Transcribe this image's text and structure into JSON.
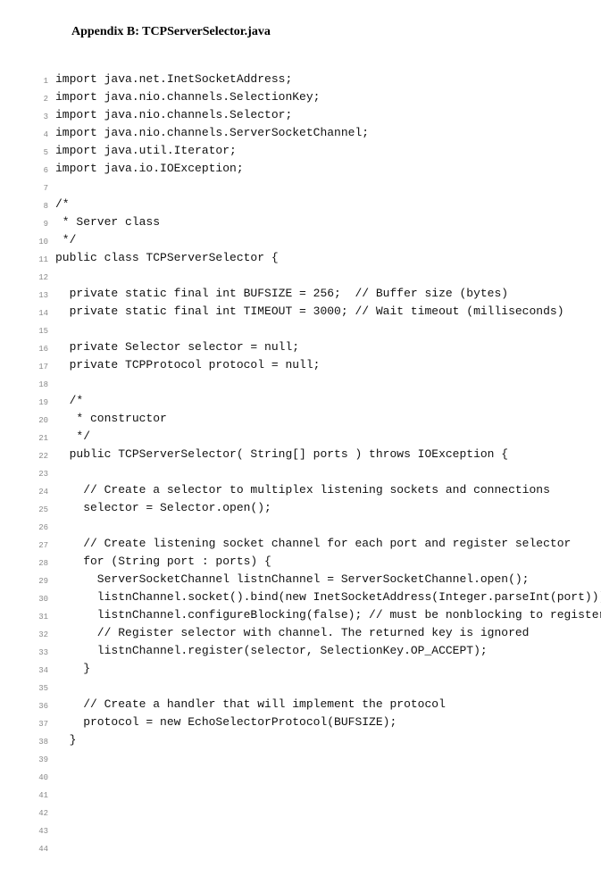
{
  "title": "Appendix B: TCPServerSelector.java",
  "code": {
    "lines": [
      {
        "n": 1,
        "t": "import java.net.InetSocketAddress;"
      },
      {
        "n": 2,
        "t": "import java.nio.channels.SelectionKey;"
      },
      {
        "n": 3,
        "t": "import java.nio.channels.Selector;"
      },
      {
        "n": 4,
        "t": "import java.nio.channels.ServerSocketChannel;"
      },
      {
        "n": 5,
        "t": "import java.util.Iterator;"
      },
      {
        "n": 6,
        "t": "import java.io.IOException;"
      },
      {
        "n": 7,
        "t": ""
      },
      {
        "n": 8,
        "t": "/*"
      },
      {
        "n": 9,
        "t": " * Server class"
      },
      {
        "n": 10,
        "t": " */"
      },
      {
        "n": 11,
        "t": "public class TCPServerSelector {"
      },
      {
        "n": 12,
        "t": ""
      },
      {
        "n": 13,
        "t": "  private static final int BUFSIZE = 256;  // Buffer size (bytes)"
      },
      {
        "n": 14,
        "t": "  private static final int TIMEOUT = 3000; // Wait timeout (milliseconds)"
      },
      {
        "n": 15,
        "t": ""
      },
      {
        "n": 16,
        "t": "  private Selector selector = null;"
      },
      {
        "n": 17,
        "t": "  private TCPProtocol protocol = null;"
      },
      {
        "n": 18,
        "t": ""
      },
      {
        "n": 19,
        "t": "  /*"
      },
      {
        "n": 20,
        "t": "   * constructor"
      },
      {
        "n": 21,
        "t": "   */"
      },
      {
        "n": 22,
        "t": "  public TCPServerSelector( String[] ports ) throws IOException {"
      },
      {
        "n": 23,
        "t": ""
      },
      {
        "n": 24,
        "t": "    // Create a selector to multiplex listening sockets and connections"
      },
      {
        "n": 25,
        "t": "    selector = Selector.open();"
      },
      {
        "n": 26,
        "t": ""
      },
      {
        "n": 27,
        "t": "    // Create listening socket channel for each port and register selector"
      },
      {
        "n": 28,
        "t": "    for (String port : ports) {"
      },
      {
        "n": 29,
        "t": "      ServerSocketChannel listnChannel = ServerSocketChannel.open();"
      },
      {
        "n": 30,
        "t": "      listnChannel.socket().bind(new InetSocketAddress(Integer.parseInt(port)));"
      },
      {
        "n": 31,
        "t": "      listnChannel.configureBlocking(false); // must be nonblocking to register"
      },
      {
        "n": 32,
        "t": "      // Register selector with channel. The returned key is ignored"
      },
      {
        "n": 33,
        "t": "      listnChannel.register(selector, SelectionKey.OP_ACCEPT);"
      },
      {
        "n": 34,
        "t": "    }"
      },
      {
        "n": 35,
        "t": ""
      },
      {
        "n": 36,
        "t": "    // Create a handler that will implement the protocol"
      },
      {
        "n": 37,
        "t": "    protocol = new EchoSelectorProtocol(BUFSIZE);"
      },
      {
        "n": 38,
        "t": "  }"
      },
      {
        "n": 39,
        "t": ""
      },
      {
        "n": 40,
        "t": ""
      },
      {
        "n": 41,
        "t": ""
      },
      {
        "n": 42,
        "t": ""
      },
      {
        "n": 43,
        "t": ""
      },
      {
        "n": 44,
        "t": ""
      }
    ]
  }
}
